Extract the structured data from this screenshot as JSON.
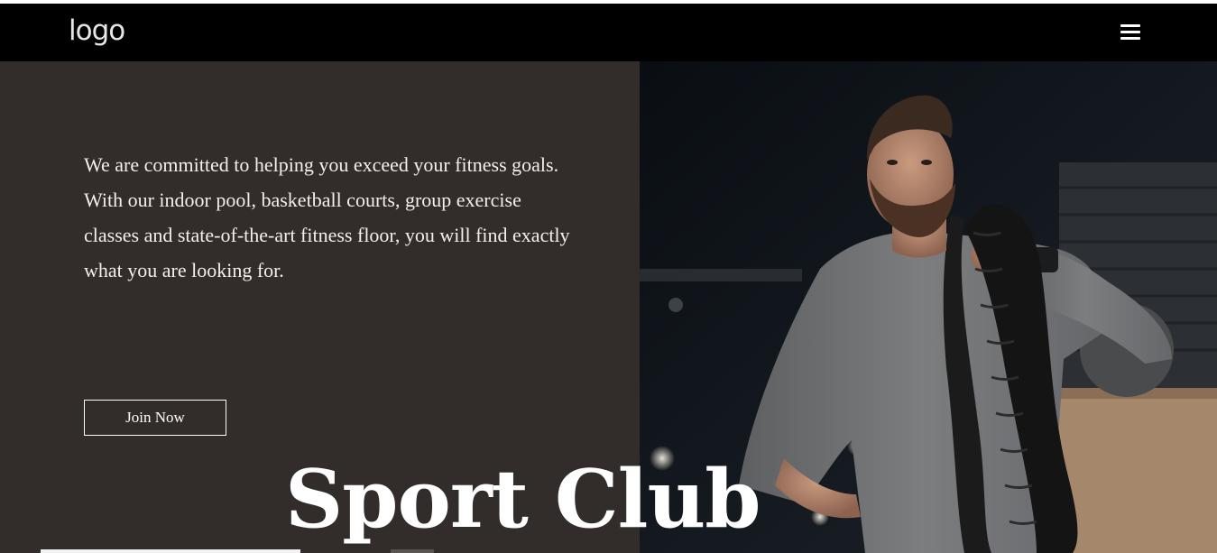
{
  "header": {
    "logo_text": "logo",
    "menu_icon": "hamburger-menu-icon"
  },
  "hero": {
    "description": "We are committed to helping you exceed your fitness goals. With our indoor pool, basketball courts, group exercise classes and state-of-the-art fitness floor, you will find exactly what you are looking for.",
    "join_button_label": "Join Now",
    "title": "Sport Club",
    "image_subject": "man in grey athletic shirt carrying battle rope in gym"
  },
  "colors": {
    "navbar_bg": "#000000",
    "panel_bg": "#322d2a",
    "text": "#ffffff"
  }
}
